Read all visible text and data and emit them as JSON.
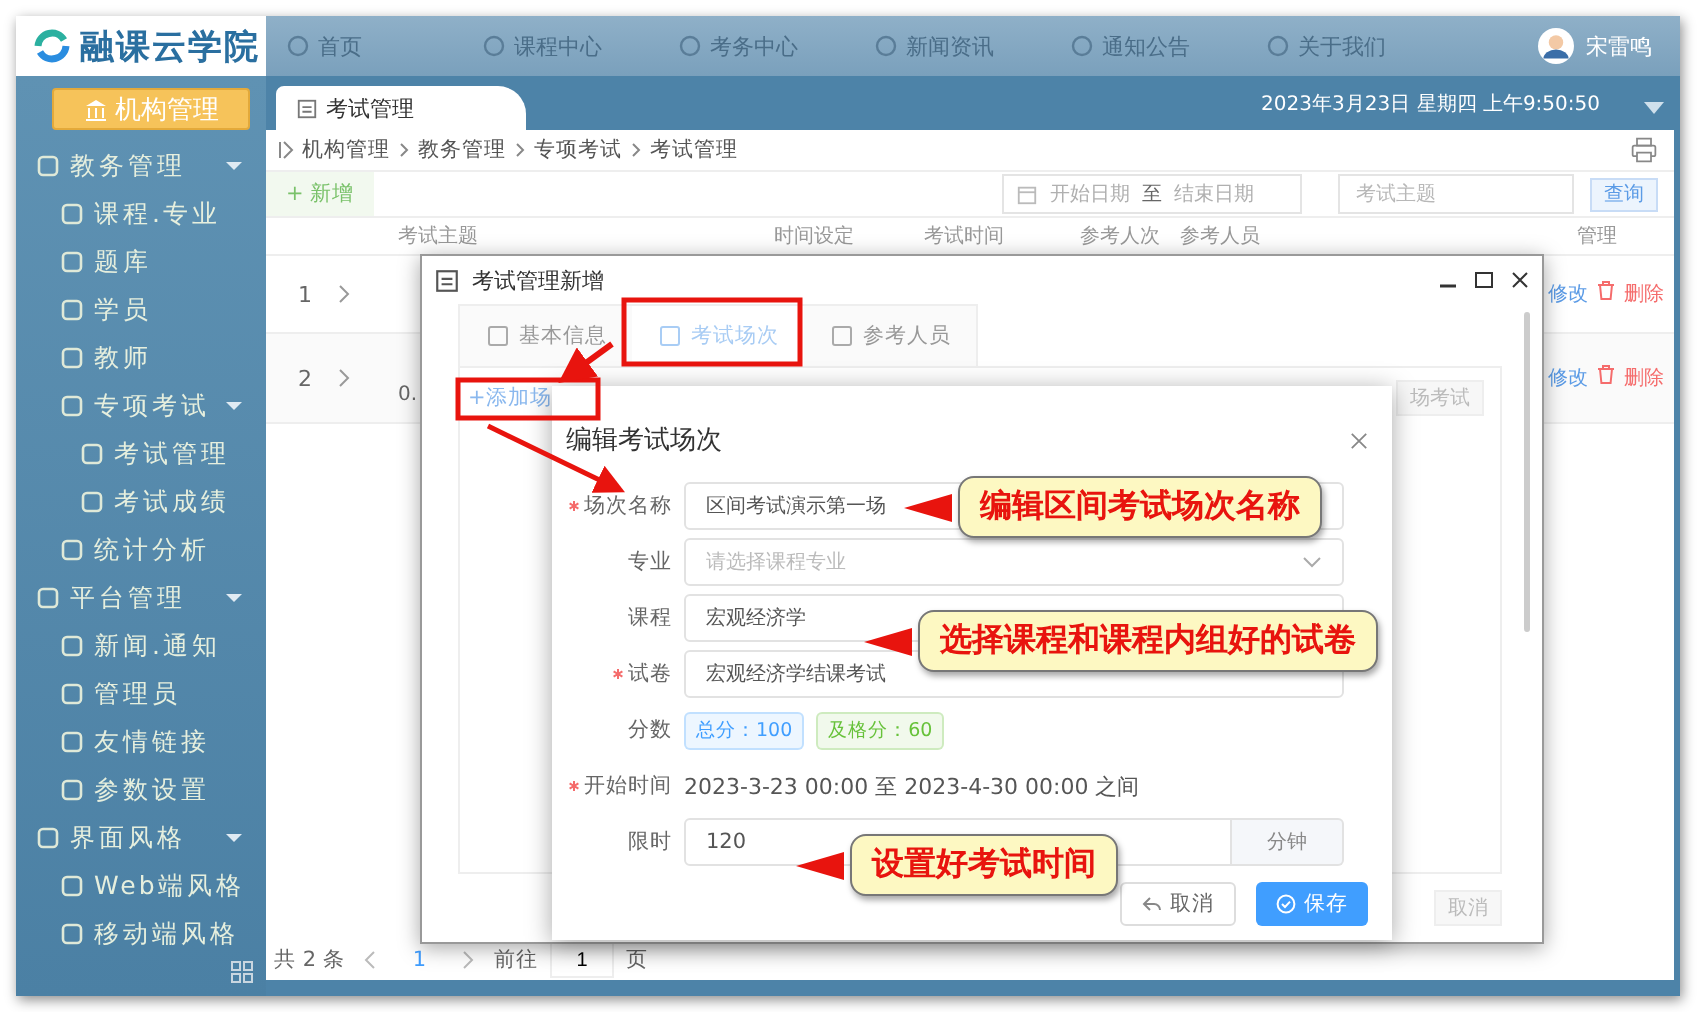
{
  "logo": {
    "text": "融课云学院"
  },
  "nav": [
    {
      "label": "首页"
    },
    {
      "label": "课程中心"
    },
    {
      "label": "考务中心"
    },
    {
      "label": "新闻资讯"
    },
    {
      "label": "通知公告"
    },
    {
      "label": "关于我们"
    }
  ],
  "user": {
    "name": "宋雷鸣"
  },
  "sidebar": {
    "org_button": "机构管理",
    "groups": [
      {
        "label": "教务管理",
        "expanded": true,
        "children": [
          {
            "label": "课程.专业"
          },
          {
            "label": "题库"
          },
          {
            "label": "学员"
          },
          {
            "label": "教师"
          },
          {
            "label": "专项考试",
            "expanded": true,
            "children": [
              {
                "label": "考试管理"
              },
              {
                "label": "考试成绩"
              }
            ]
          },
          {
            "label": "统计分析"
          }
        ]
      },
      {
        "label": "平台管理",
        "expanded": true,
        "children": [
          {
            "label": "新闻.通知"
          },
          {
            "label": "管理员"
          },
          {
            "label": "友情链接"
          },
          {
            "label": "参数设置"
          }
        ]
      },
      {
        "label": "界面风格",
        "expanded": true,
        "children": [
          {
            "label": "Web端风格"
          },
          {
            "label": "移动端风格"
          }
        ]
      }
    ]
  },
  "page_tab": {
    "label": "考试管理"
  },
  "datetime": "2023年3月23日 星期四 上午9:50:50",
  "breadcrumb": [
    "机构管理",
    "教务管理",
    "专项考试",
    "考试管理"
  ],
  "toolbar": {
    "add_button": "+ 新增",
    "start_placeholder": "开始日期",
    "range_separator": "至",
    "end_placeholder": "结束日期",
    "search_placeholder": "考试主题",
    "search_button": "查询"
  },
  "table": {
    "columns": [
      "考试主题",
      "时间设定",
      "考试时间",
      "参考人次",
      "参考人员",
      "管理"
    ],
    "rows": [
      {
        "index": "1",
        "subject": "",
        "actions": [
          "修改",
          "删除"
        ]
      },
      {
        "index": "2",
        "subject": "0.",
        "actions": [
          "修改",
          "删除"
        ]
      }
    ]
  },
  "pagination": {
    "total": "共 2 条",
    "page": "1",
    "goto_label": "前往",
    "goto_value": "1",
    "page_unit": "页"
  },
  "dialog": {
    "title": "考试管理新增",
    "tabs": [
      {
        "label": "基本信息",
        "selected": false
      },
      {
        "label": "考试场次",
        "selected": true
      },
      {
        "label": "参考人员",
        "selected": false
      }
    ],
    "add_link": "+添加场",
    "hidden_button": "场考试",
    "cancel_button": "取消"
  },
  "edit_dialog": {
    "title": "编辑考试场次",
    "fields": [
      {
        "kind": "input",
        "label": "场次名称",
        "required": true,
        "value": "区间考试演示第一场"
      },
      {
        "kind": "select",
        "label": "专业",
        "required": false,
        "placeholder": "请选择课程专业"
      },
      {
        "kind": "input",
        "label": "课程",
        "required": false,
        "value": "宏观经济学"
      },
      {
        "kind": "input",
        "label": "试卷",
        "required": true,
        "value": "宏观经济学结课考试"
      },
      {
        "kind": "tags",
        "label": "分数",
        "required": false,
        "tags": [
          {
            "text": "总分：100",
            "color": "#409eff"
          },
          {
            "text": "及格分：60",
            "color": "#67c23a"
          }
        ]
      },
      {
        "kind": "text",
        "label": "开始时间",
        "required": true,
        "text": "2023-3-23 00:00 至 2023-4-30 00:00 之间"
      },
      {
        "kind": "addon",
        "label": "限时",
        "required": false,
        "value": "120",
        "suffix": "分钟"
      }
    ],
    "cancel_button": "取消",
    "save_button": "保存"
  },
  "callouts": [
    "编辑区间考试场次名称",
    "选择课程和课程内组好的试卷",
    "设置好考试时间"
  ]
}
